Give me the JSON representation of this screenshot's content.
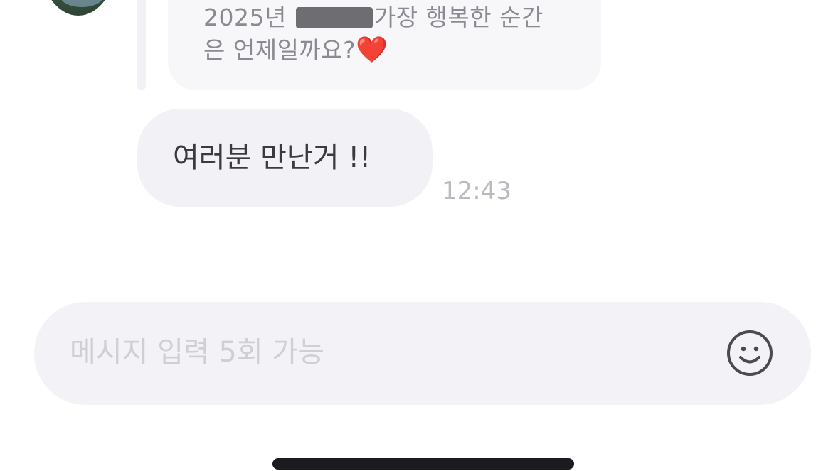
{
  "quoted_message": {
    "line1_prefix": "2025년",
    "line1_suffix": "가장 행복한 순간",
    "line2": "은 언제일까요?",
    "heart": "❤️"
  },
  "message": {
    "text": "여러분 만난거 !!",
    "time": "12:43"
  },
  "composer": {
    "placeholder": "메시지 입력 5회 가능",
    "emoji_icon": "smiley-face-icon"
  },
  "colors": {
    "bubble": "#f2f2f6",
    "quote_text": "#8a8a92",
    "timestamp": "#b9b9bf",
    "placeholder": "#cfcfd5",
    "heart": "#e0242b"
  }
}
